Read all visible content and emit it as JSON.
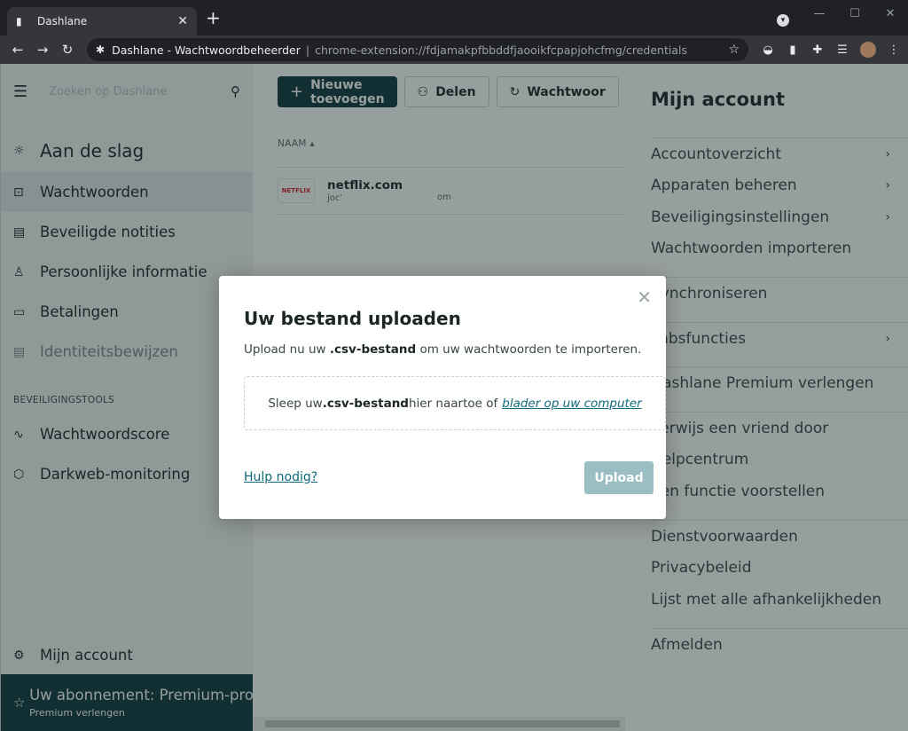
{
  "browser": {
    "tab_title": "Dashlane",
    "tab_favicon": "dashlane-logo-icon",
    "page_title": "Dashlane - Wachtwoordbeheerder",
    "url": "chrome-extension://fdjamakpfbbddfjaooikfcpapjohcfmg/credentials"
  },
  "sidebar": {
    "search_placeholder": "Zoeken op Dashlane",
    "start_label": "Aan de slag",
    "items": [
      {
        "label": "Wachtwoorden",
        "icon": "lock-icon"
      },
      {
        "label": "Beveiligde notities",
        "icon": "note-icon"
      },
      {
        "label": "Persoonlijke informatie",
        "icon": "person-icon"
      },
      {
        "label": "Betalingen",
        "icon": "card-icon"
      },
      {
        "label": "Identiteitsbewijzen",
        "icon": "id-icon"
      }
    ],
    "section_title": "BEVEILIGINGSTOOLS",
    "tools": [
      {
        "label": "Wachtwoordscore",
        "icon": "pulse-icon"
      },
      {
        "label": "Darkweb-monitoring",
        "icon": "web-icon"
      }
    ],
    "account_label": "Mijn account",
    "premium_title": "Uw abonnement: Premium-pro",
    "premium_sub": "Premium verlengen"
  },
  "main": {
    "new_button": "Nieuwe toevoegen",
    "share_button": "Delen",
    "passwords_button": "Wachtwoor",
    "column_name": "NAAM",
    "rows": [
      {
        "logo": "NETFLIX",
        "name": "netflix.com",
        "login": "joc'",
        "email": "om"
      }
    ]
  },
  "account_panel": {
    "title": "Mijn account",
    "group1": [
      {
        "label": "Accountoverzicht",
        "chevron": true
      },
      {
        "label": "Apparaten beheren",
        "chevron": true
      },
      {
        "label": "Beveiligingsinstellingen",
        "chevron": true
      },
      {
        "label": "Wachtwoorden importeren",
        "chevron": false
      }
    ],
    "group2": [
      {
        "label": "Synchroniseren",
        "chevron": false
      }
    ],
    "group3": [
      {
        "label": "Labsfuncties",
        "chevron": true
      }
    ],
    "group4": [
      {
        "label": "Dashlane Premium verlengen",
        "chevron": false
      }
    ],
    "group5": [
      {
        "label": "Verwijs een vriend door",
        "chevron": false
      },
      {
        "label": "Helpcentrum",
        "chevron": false
      },
      {
        "label": "Een functie voorstellen",
        "chevron": false
      }
    ],
    "group6": [
      {
        "label": "Dienstvoorwaarden",
        "chevron": false
      },
      {
        "label": "Privacybeleid",
        "chevron": false
      },
      {
        "label": "Lijst met alle afhankelijkheden",
        "chevron": false
      }
    ],
    "group7": [
      {
        "label": "Afmelden",
        "chevron": false
      }
    ]
  },
  "modal": {
    "title": "Uw bestand uploaden",
    "desc_before": "Upload nu uw ",
    "desc_bold": ".csv-bestand",
    "desc_after": " om uw wachtwoorden te importeren.",
    "drop_before": "Sleep uw ",
    "drop_bold": ".csv-bestand",
    "drop_after": " hier naartoe of",
    "drop_link": "blader op uw computer",
    "help_link": "Hulp nodig?",
    "upload_button": "Upload"
  },
  "colors": {
    "primary": "#0e353d",
    "link": "#0e6a7a",
    "upload_disabled": "#9bbec4"
  }
}
